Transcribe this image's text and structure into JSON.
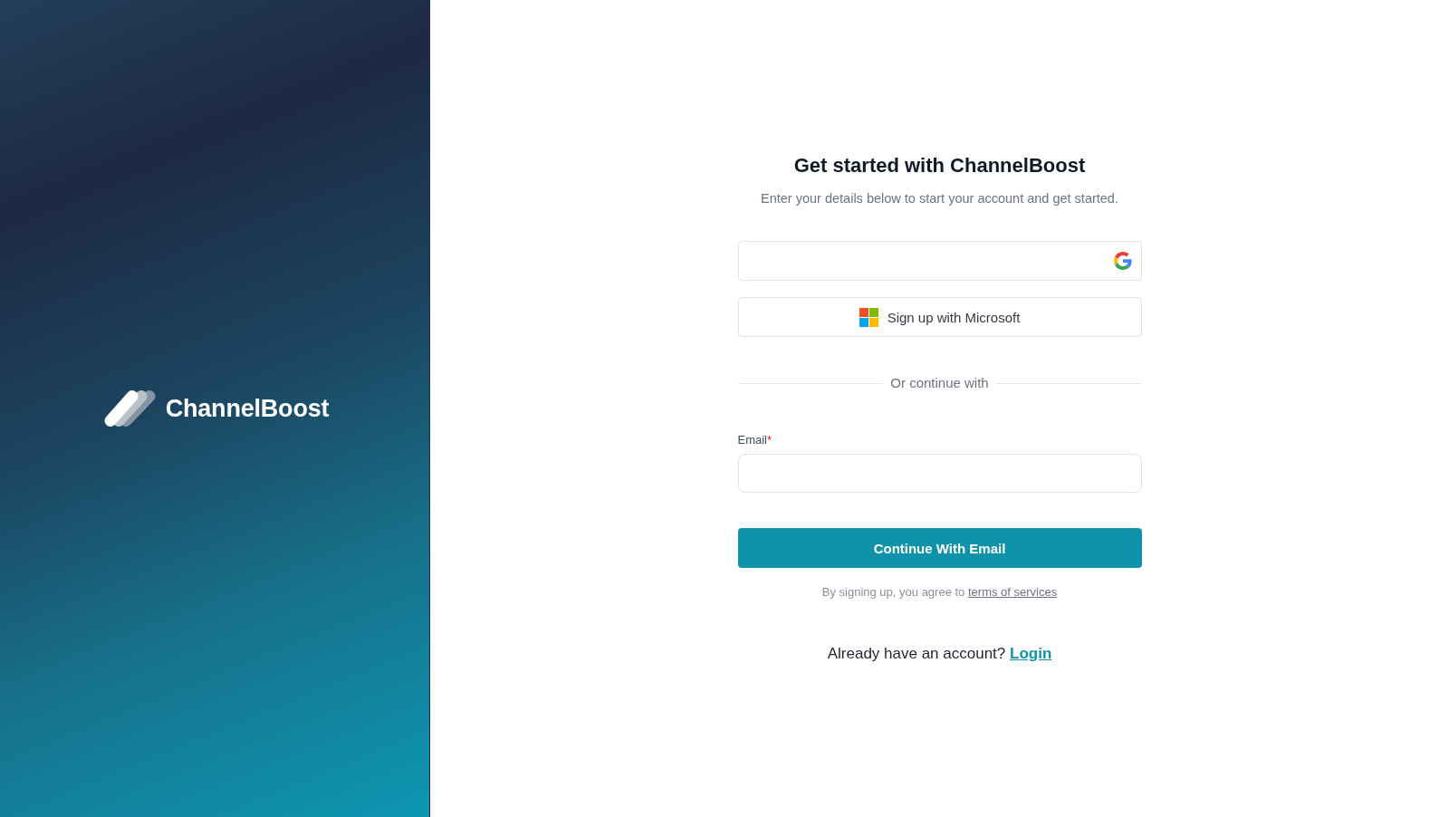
{
  "brand": {
    "name": "ChannelBoost"
  },
  "form": {
    "title": "Get started with ChannelBoost",
    "subtitle": "Enter your details below to start your account and get started.",
    "social_buttons": [
      {
        "kind": "google"
      },
      {
        "kind": "microsoft",
        "label": "Sign up with Microsoft"
      }
    ],
    "divider": "Or continue with",
    "email": {
      "label": "Email",
      "required_mark": "*"
    },
    "submit": "Continue With Email",
    "terms": {
      "text": "By signing up, you agree to",
      "link": "terms of services"
    },
    "login": {
      "text": "Already have an account?",
      "link": "Login"
    }
  }
}
